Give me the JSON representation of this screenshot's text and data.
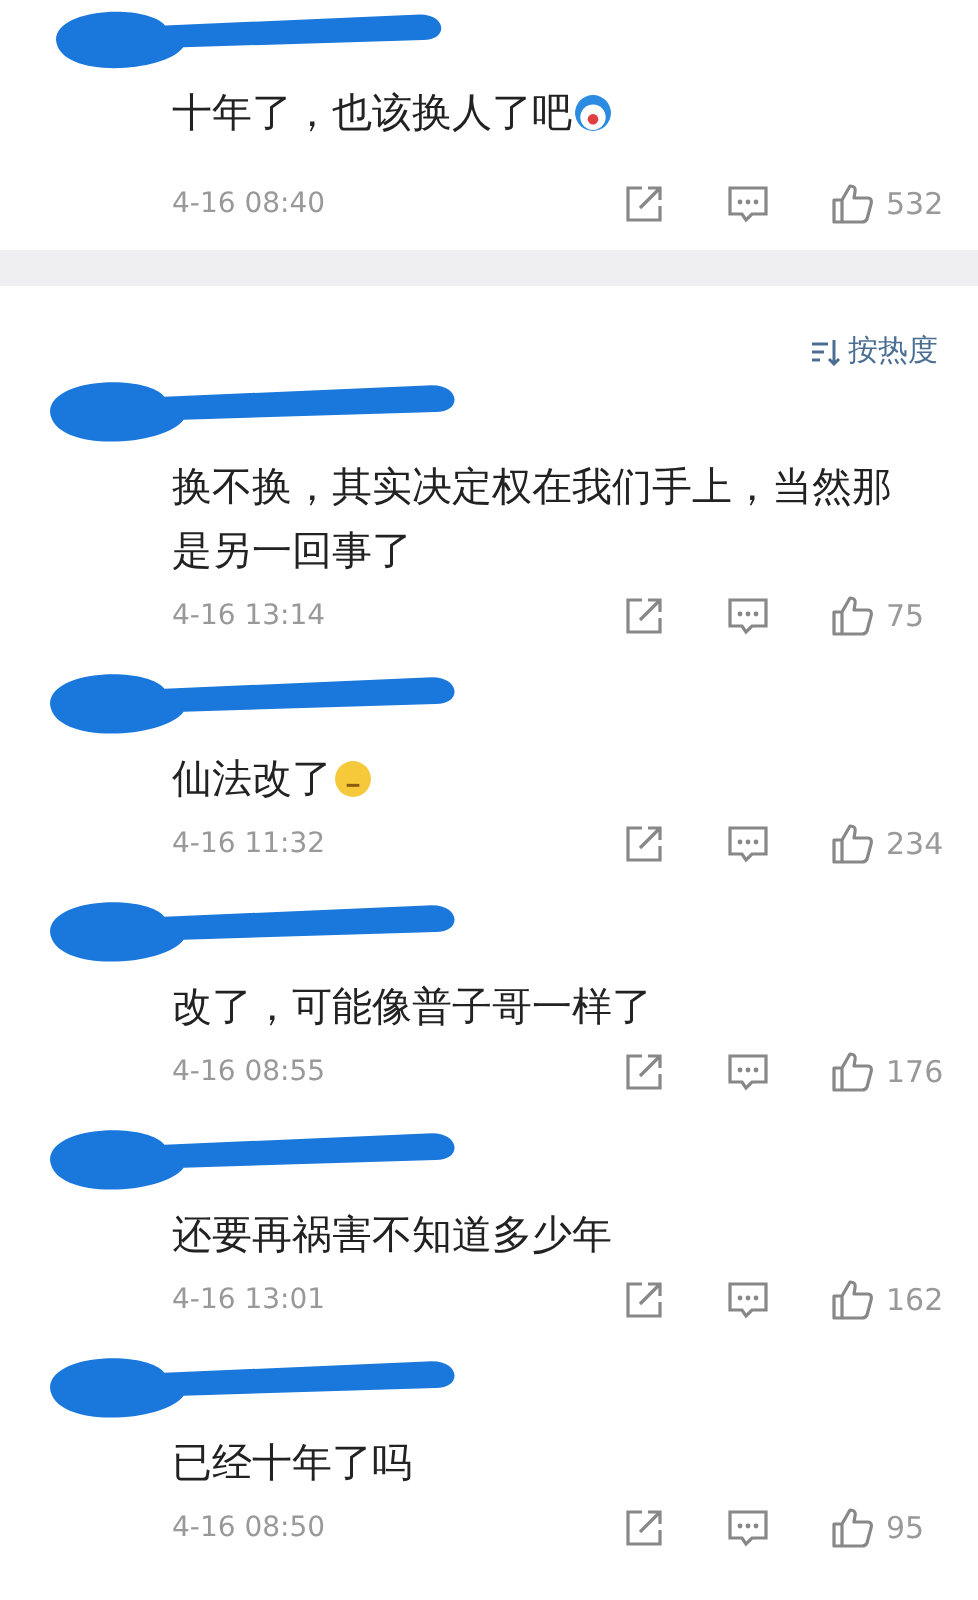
{
  "top_comment": {
    "redacted": true,
    "text": "十年了，也该换人了吧",
    "emoji": {
      "kind": "blue"
    },
    "time": "4-16 08:40",
    "likes": "532"
  },
  "sort": {
    "label": "按热度"
  },
  "comments": [
    {
      "redacted": true,
      "text": "换不换，其实决定权在我们手上，当然那是另一回事了",
      "time": "4-16 13:14",
      "likes": "75"
    },
    {
      "redacted": true,
      "text": "仙法改了",
      "emoji": {
        "kind": "yellow"
      },
      "time": "4-16 11:32",
      "likes": "234"
    },
    {
      "redacted": true,
      "text": "改了，可能像普子哥一样了",
      "time": "4-16 08:55",
      "likes": "176"
    },
    {
      "redacted": true,
      "text": "还要再祸害不知道多少年",
      "time": "4-16 13:01",
      "likes": "162"
    },
    {
      "redacted": true,
      "text": "已经十年了吗",
      "time": "4-16 08:50",
      "likes": "95"
    }
  ]
}
